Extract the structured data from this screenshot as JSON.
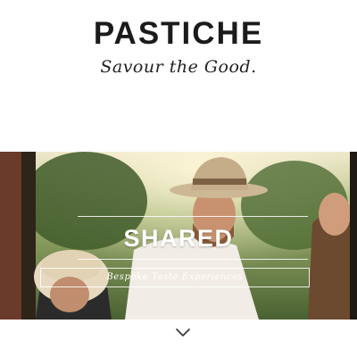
{
  "brand": {
    "logo_text": "PASTICHE",
    "tagline": "Savour the Good."
  },
  "hero": {
    "title": "SHARED",
    "subtitle": "Bespoke Taste Experiences",
    "image": "outdoor-tasting-photo"
  },
  "scroll": {
    "icon": "chevron-down-icon"
  },
  "colors": {
    "logo": "#1b1b1b",
    "hero_text": "#ffffff",
    "chevron": "#333333"
  }
}
